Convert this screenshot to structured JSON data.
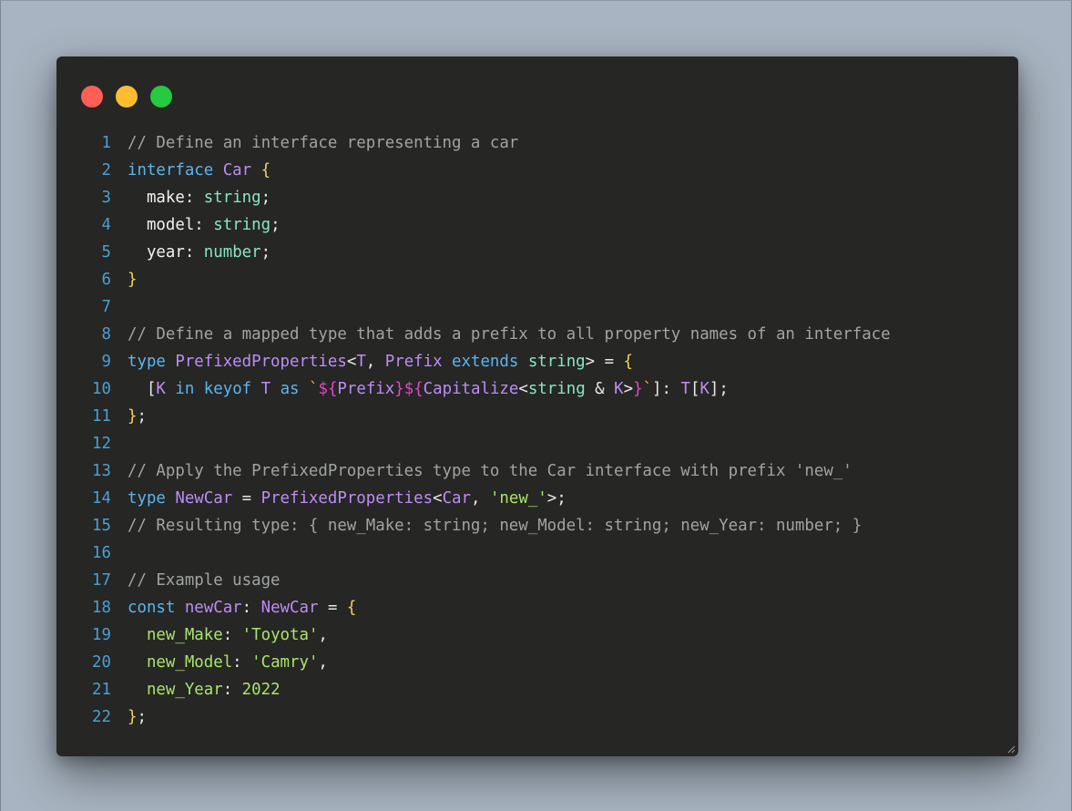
{
  "window_controls": {
    "close": {
      "name": "close",
      "color": "#ff5f57"
    },
    "minimize": {
      "name": "minimize",
      "color": "#febc2e"
    },
    "maximize": {
      "name": "maximize",
      "color": "#28c840"
    }
  },
  "code_lines": [
    {
      "n": "1",
      "tokens": [
        {
          "c": "com",
          "t": "// Define an interface representing a car"
        }
      ]
    },
    {
      "n": "2",
      "tokens": [
        {
          "c": "kw",
          "t": "interface "
        },
        {
          "c": "type",
          "t": "Car "
        },
        {
          "c": "brace",
          "t": "{"
        }
      ]
    },
    {
      "n": "3",
      "tokens": [
        {
          "c": "prop",
          "t": "  make"
        },
        {
          "c": "pun",
          "t": ": "
        },
        {
          "c": "prim",
          "t": "string"
        },
        {
          "c": "pun",
          "t": ";"
        }
      ]
    },
    {
      "n": "4",
      "tokens": [
        {
          "c": "prop",
          "t": "  model"
        },
        {
          "c": "pun",
          "t": ": "
        },
        {
          "c": "prim",
          "t": "string"
        },
        {
          "c": "pun",
          "t": ";"
        }
      ]
    },
    {
      "n": "5",
      "tokens": [
        {
          "c": "prop",
          "t": "  year"
        },
        {
          "c": "pun",
          "t": ": "
        },
        {
          "c": "prim",
          "t": "number"
        },
        {
          "c": "pun",
          "t": ";"
        }
      ]
    },
    {
      "n": "6",
      "tokens": [
        {
          "c": "brace",
          "t": "}"
        }
      ]
    },
    {
      "n": "7",
      "tokens": []
    },
    {
      "n": "8",
      "tokens": [
        {
          "c": "com",
          "t": "// Define a mapped type that adds a prefix to all property names of an interface"
        }
      ]
    },
    {
      "n": "9",
      "tokens": [
        {
          "c": "kw",
          "t": "type "
        },
        {
          "c": "type",
          "t": "PrefixedProperties"
        },
        {
          "c": "pun",
          "t": "<"
        },
        {
          "c": "type",
          "t": "T"
        },
        {
          "c": "pun",
          "t": ", "
        },
        {
          "c": "type",
          "t": "Prefix "
        },
        {
          "c": "kw",
          "t": "extends "
        },
        {
          "c": "prim",
          "t": "string"
        },
        {
          "c": "pun",
          "t": "> = "
        },
        {
          "c": "brace",
          "t": "{"
        }
      ]
    },
    {
      "n": "10",
      "tokens": [
        {
          "c": "pun",
          "t": "  ["
        },
        {
          "c": "type",
          "t": "K "
        },
        {
          "c": "kw",
          "t": "in keyof "
        },
        {
          "c": "type",
          "t": "T "
        },
        {
          "c": "kw",
          "t": "as "
        },
        {
          "c": "tick",
          "t": "`"
        },
        {
          "c": "tpl",
          "t": "${"
        },
        {
          "c": "type",
          "t": "Prefix"
        },
        {
          "c": "tpl",
          "t": "}${"
        },
        {
          "c": "type",
          "t": "Capitalize"
        },
        {
          "c": "pun",
          "t": "<"
        },
        {
          "c": "prim",
          "t": "string"
        },
        {
          "c": "pun",
          "t": " & "
        },
        {
          "c": "type",
          "t": "K"
        },
        {
          "c": "pun",
          "t": ">"
        },
        {
          "c": "tpl",
          "t": "}"
        },
        {
          "c": "tick",
          "t": "`"
        },
        {
          "c": "pun",
          "t": "]: "
        },
        {
          "c": "type",
          "t": "T"
        },
        {
          "c": "pun",
          "t": "["
        },
        {
          "c": "type",
          "t": "K"
        },
        {
          "c": "pun",
          "t": "];"
        }
      ]
    },
    {
      "n": "11",
      "tokens": [
        {
          "c": "brace",
          "t": "}"
        },
        {
          "c": "pun",
          "t": ";"
        }
      ]
    },
    {
      "n": "12",
      "tokens": []
    },
    {
      "n": "13",
      "tokens": [
        {
          "c": "com",
          "t": "// Apply the PrefixedProperties type to the Car interface with prefix 'new_'"
        }
      ]
    },
    {
      "n": "14",
      "tokens": [
        {
          "c": "kw",
          "t": "type "
        },
        {
          "c": "type",
          "t": "NewCar "
        },
        {
          "c": "pun",
          "t": "= "
        },
        {
          "c": "type",
          "t": "PrefixedProperties"
        },
        {
          "c": "pun",
          "t": "<"
        },
        {
          "c": "type",
          "t": "Car"
        },
        {
          "c": "pun",
          "t": ", "
        },
        {
          "c": "str",
          "t": "'new_'"
        },
        {
          "c": "pun",
          "t": ">;"
        }
      ]
    },
    {
      "n": "15",
      "tokens": [
        {
          "c": "com",
          "t": "// Resulting type: { new_Make: string; new_Model: string; new_Year: number; }"
        }
      ]
    },
    {
      "n": "16",
      "tokens": []
    },
    {
      "n": "17",
      "tokens": [
        {
          "c": "com",
          "t": "// Example usage"
        }
      ]
    },
    {
      "n": "18",
      "tokens": [
        {
          "c": "kw",
          "t": "const "
        },
        {
          "c": "type",
          "t": "newCar"
        },
        {
          "c": "pun",
          "t": ": "
        },
        {
          "c": "type",
          "t": "NewCar "
        },
        {
          "c": "pun",
          "t": "= "
        },
        {
          "c": "brace",
          "t": "{"
        }
      ]
    },
    {
      "n": "19",
      "tokens": [
        {
          "c": "str",
          "t": "  new_Make"
        },
        {
          "c": "pun",
          "t": ": "
        },
        {
          "c": "str",
          "t": "'Toyota'"
        },
        {
          "c": "pun",
          "t": ","
        }
      ]
    },
    {
      "n": "20",
      "tokens": [
        {
          "c": "str",
          "t": "  new_Model"
        },
        {
          "c": "pun",
          "t": ": "
        },
        {
          "c": "str",
          "t": "'Camry'"
        },
        {
          "c": "pun",
          "t": ","
        }
      ]
    },
    {
      "n": "21",
      "tokens": [
        {
          "c": "str",
          "t": "  new_Year"
        },
        {
          "c": "pun",
          "t": ": "
        },
        {
          "c": "num",
          "t": "2022"
        }
      ]
    },
    {
      "n": "22",
      "tokens": [
        {
          "c": "brace",
          "t": "}"
        },
        {
          "c": "pun",
          "t": ";"
        }
      ]
    }
  ]
}
